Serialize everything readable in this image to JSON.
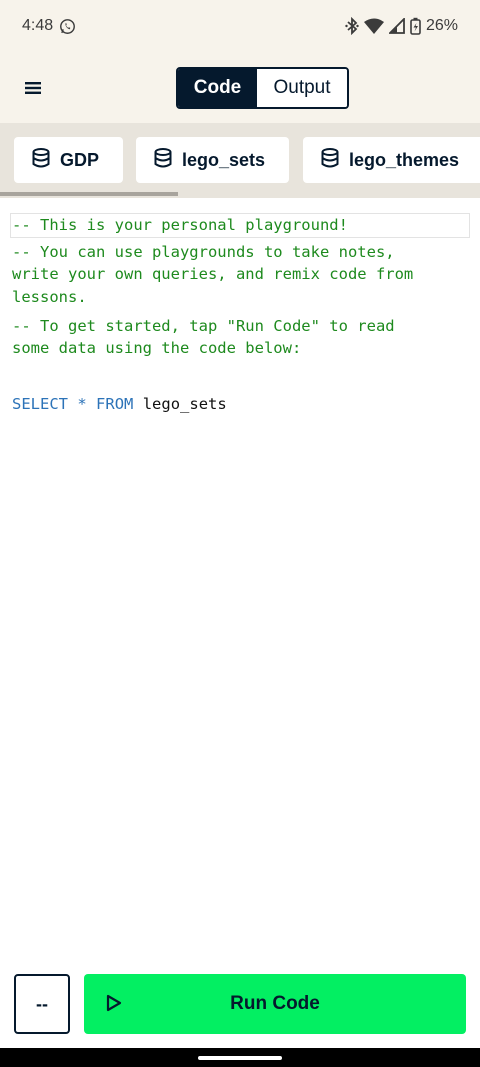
{
  "status_bar": {
    "time": "4:48",
    "battery": "26%",
    "icons": [
      "whatsapp-icon",
      "bluetooth-icon",
      "wifi-icon",
      "signal-icon",
      "battery-icon"
    ]
  },
  "header": {
    "menu_icon": "hamburger-menu-icon",
    "toggle": {
      "code_label": "Code",
      "output_label": "Output",
      "selected": "Code"
    }
  },
  "tables": [
    {
      "label": "GDP",
      "icon": "database-icon"
    },
    {
      "label": "lego_sets",
      "icon": "database-icon"
    },
    {
      "label": "lego_themes",
      "icon": "database-icon"
    }
  ],
  "editor": {
    "lines": [
      "-- This is your personal playground!",
      "-- You can use playgrounds to take notes,",
      "write your own queries, and remix code from",
      "lessons.",
      "-- To get started, tap \"Run Code\" to read",
      "some data using the code below:"
    ],
    "query": {
      "select": "SELECT",
      "star": "*",
      "from": "FROM",
      "table": "lego_sets"
    }
  },
  "bottom": {
    "dash_label": "--",
    "run_label": "Run Code",
    "run_icon": "play-icon"
  },
  "colors": {
    "dark_navy": "#05192d",
    "accent_green": "#03ef62",
    "header_bg": "#f7f3eb",
    "comment_green": "#1e8a1e",
    "keyword_blue": "#2c73b8"
  }
}
